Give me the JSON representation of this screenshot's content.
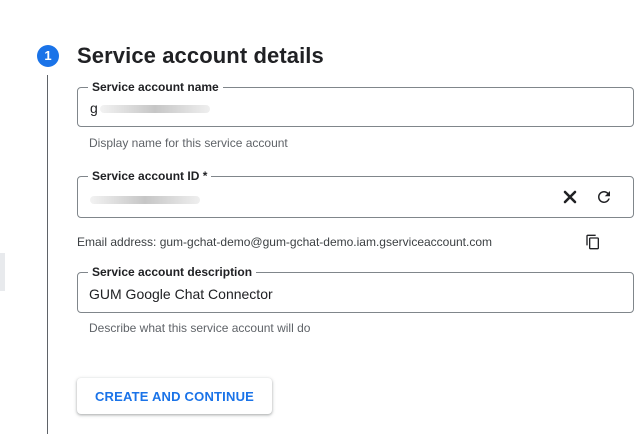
{
  "step": {
    "number": "1",
    "title": "Service account details"
  },
  "fields": {
    "name": {
      "label": "Service account name",
      "value_prefix": "g",
      "hint": "Display name for this service account"
    },
    "id": {
      "label": "Service account ID *",
      "value_prefix": "",
      "clear_icon": "close-icon",
      "refresh_icon": "refresh-icon"
    },
    "email": {
      "text": "Email address: gum-gchat-demo@gum-gchat-demo.iam.gserviceaccount.com",
      "copy_icon": "copy-icon"
    },
    "description": {
      "label": "Service account description",
      "value": "GUM Google Chat Connector",
      "hint": "Describe what this service account will do"
    }
  },
  "actions": {
    "create_continue": "CREATE AND CONTINUE"
  },
  "colors": {
    "accent": "#1a73e8",
    "text": "#202124",
    "hint": "#5f6368",
    "border": "#80868b"
  }
}
